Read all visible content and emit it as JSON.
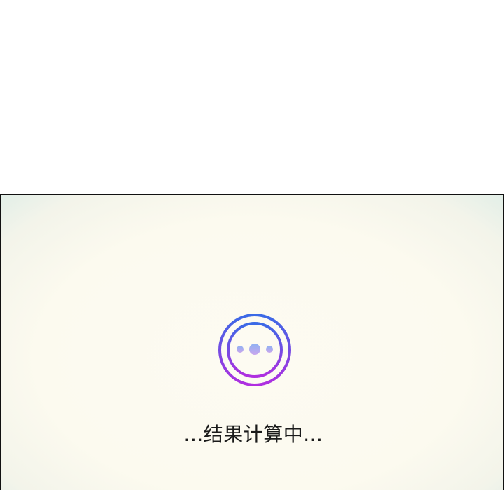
{
  "loading": {
    "status_text": "...结果计算中...",
    "spinner_icon": "loading-spinner-icon"
  },
  "colors": {
    "ring_top": "#3a6ae6",
    "ring_bottom": "#b02ee0",
    "dot": "#a7b0ee",
    "dot_center": "#9fb4f0",
    "text": "#1a1a1a",
    "panel_border": "#111111"
  }
}
